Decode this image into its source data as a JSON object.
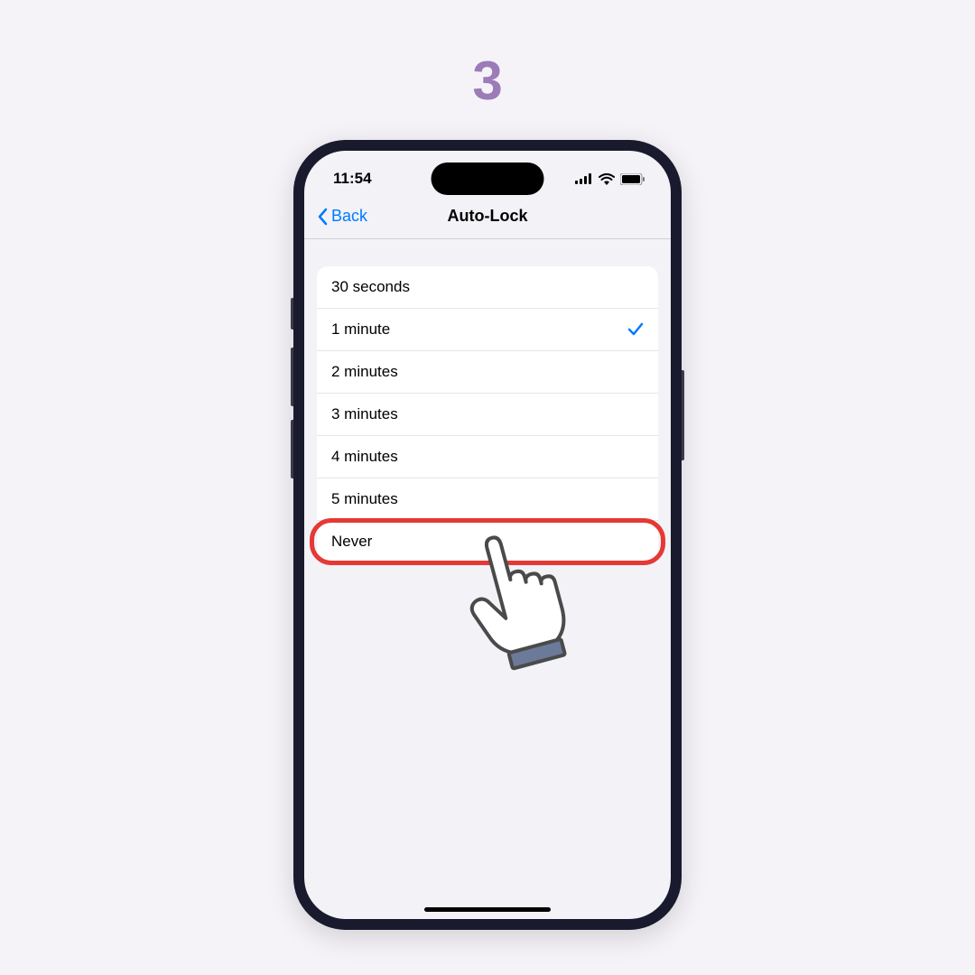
{
  "step_number": "3",
  "status_bar": {
    "time": "11:54"
  },
  "nav": {
    "back_label": "Back",
    "title": "Auto-Lock"
  },
  "options": [
    {
      "label": "30 seconds",
      "selected": false
    },
    {
      "label": "1 minute",
      "selected": true
    },
    {
      "label": "2 minutes",
      "selected": false
    },
    {
      "label": "3 minutes",
      "selected": false
    },
    {
      "label": "4 minutes",
      "selected": false
    },
    {
      "label": "5 minutes",
      "selected": false
    },
    {
      "label": "Never",
      "selected": false,
      "highlighted": true
    }
  ]
}
